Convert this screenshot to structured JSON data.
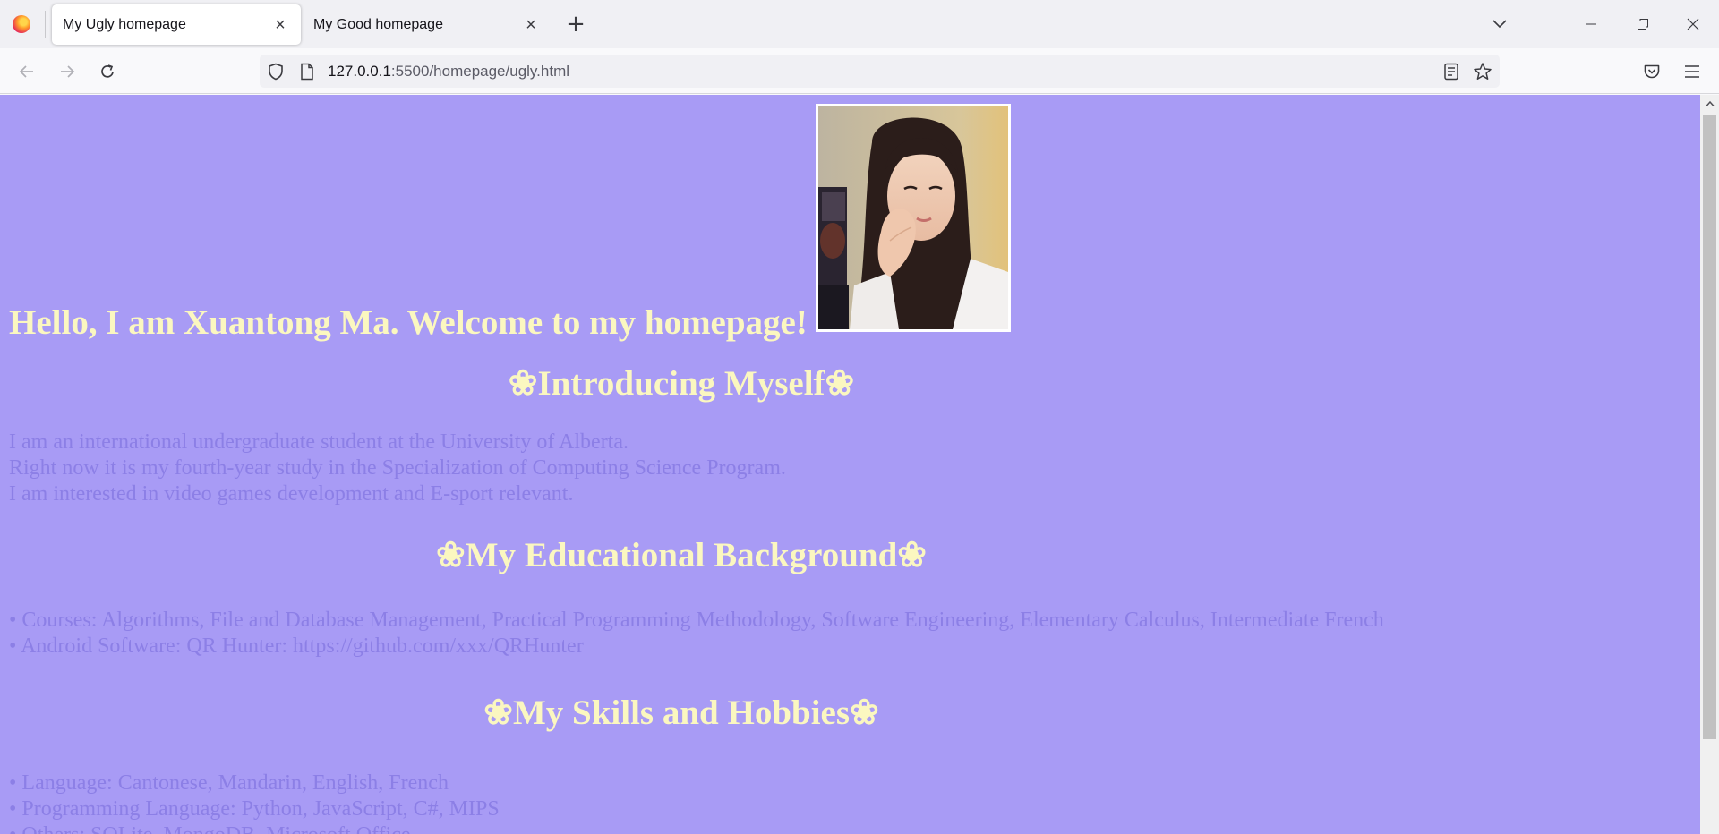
{
  "browser": {
    "tabs": [
      {
        "title": "My Ugly homepage",
        "active": true
      },
      {
        "title": "My Good homepage",
        "active": false
      }
    ],
    "close_glyph": "×",
    "newtab_glyph": "+",
    "url": {
      "host": "127.0.0.1",
      "rest": ":5500/homepage/ugly.html"
    },
    "icons": [
      "firefox-logo-icon",
      "back-icon",
      "forward-icon",
      "reload-icon",
      "shield-icon",
      "page-icon",
      "reader-view-icon",
      "bookmark-star-icon",
      "pocket-icon",
      "menu-icon",
      "list-all-tabs-icon",
      "minimize-icon",
      "restore-icon",
      "close-window-icon"
    ]
  },
  "page": {
    "background": "#a89bf5",
    "heading_color": "#fbf7c0",
    "text_color": "#8c7fe6",
    "title": "Hello, I am Xuantong Ma. Welcome to my homepage!",
    "sections": [
      {
        "heading": "❀Introducing Myself❀",
        "lines": [
          "I am an international undergraduate student at the University of Alberta.",
          "Right now it is my fourth-year study in the Specialization of Computing Science Program.",
          "I am interested in video games development and E-sport relevant."
        ]
      },
      {
        "heading": "❀My Educational Background❀",
        "lines": [
          "• Courses: Algorithms, File and Database Management, Practical Programming Methodology, Software Engineering, Elementary Calculus, Intermediate French",
          "• Android Software: QR Hunter: https://github.com/xxx/QRHunter"
        ]
      },
      {
        "heading": "❀My Skills and Hobbies❀",
        "lines": [
          "• Language: Cantonese, Mandarin, English, French",
          "• Programming Language: Python, JavaScript, C#, MIPS",
          "• Others: SQLite, MongoDB, Microsoft Office"
        ]
      }
    ]
  }
}
